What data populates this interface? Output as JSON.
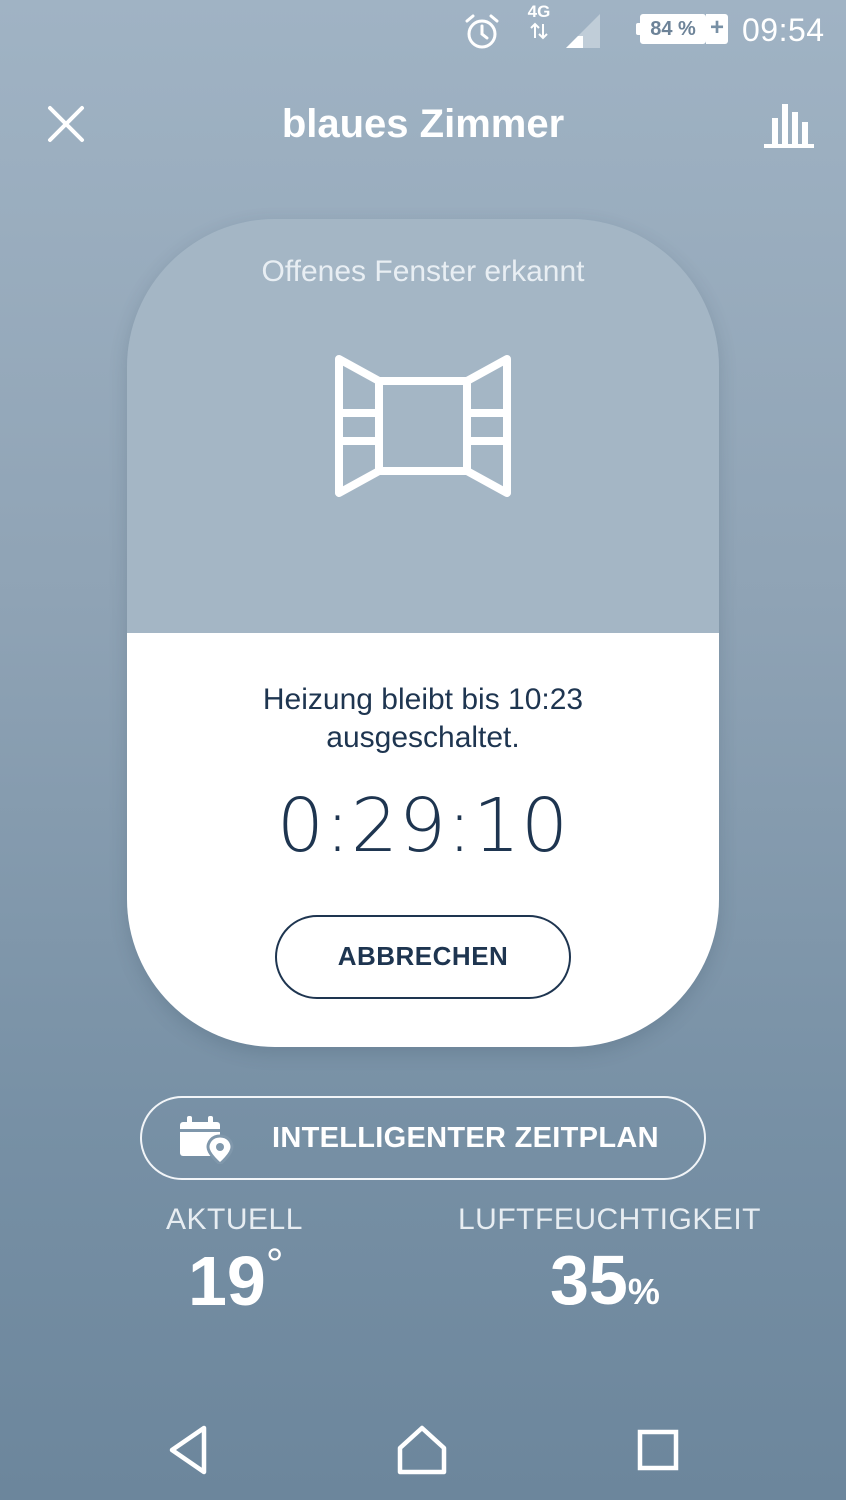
{
  "status_bar": {
    "network": "4G",
    "battery": "84 %",
    "battery_charging": "+",
    "time": "09:54",
    "icons": [
      "alarm-icon",
      "data-arrows-icon",
      "signal-icon",
      "battery-icon"
    ]
  },
  "header": {
    "title": "blaues Zimmer",
    "close_icon": "close-icon",
    "stats_icon": "bar-chart-icon"
  },
  "card": {
    "status": "Offenes Fenster erkannt",
    "icon": "open-window-icon",
    "message": "Heizung bleibt bis 10:23 ausgeschaltet.",
    "countdown": "0:29:10",
    "cancel_label": "ABBRECHEN"
  },
  "schedule": {
    "label": "INTELLIGENTER ZEITPLAN",
    "icon": "calendar-location-icon"
  },
  "readings": {
    "current_label": "AKTUELL",
    "current_value": "19",
    "current_unit": "°",
    "humidity_label": "LUFTFEUCHTIGKEIT",
    "humidity_value": "35",
    "humidity_unit": "%"
  },
  "nav": {
    "icons": [
      "back-icon",
      "home-icon",
      "recents-icon"
    ]
  },
  "colors": {
    "accent_dark": "#1e3550",
    "card_top": "#a4b6c5",
    "background_top": "#a0b3c4",
    "background_bottom": "#6c869c"
  }
}
